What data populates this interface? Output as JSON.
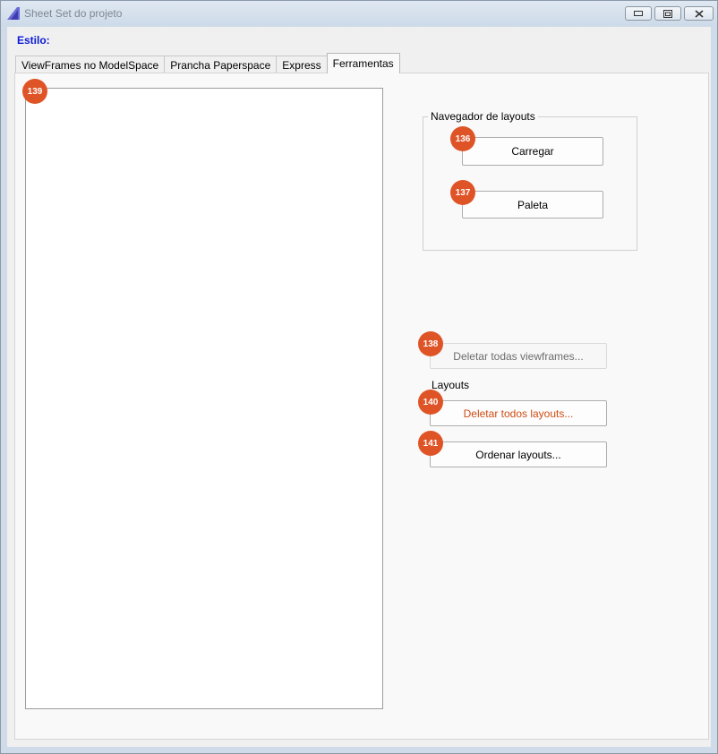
{
  "window": {
    "title": "Sheet Set do projeto",
    "controls": {
      "minimize": "minimize-icon",
      "restore": "restore-icon",
      "close": "close-icon"
    }
  },
  "estilo_label": "Estilo:",
  "tabs": [
    {
      "label": "ViewFrames no ModelSpace",
      "active": false
    },
    {
      "label": "Prancha Paperspace",
      "active": false
    },
    {
      "label": "Express",
      "active": false
    },
    {
      "label": "Ferramentas",
      "active": true
    }
  ],
  "navegador": {
    "group_label": "Navegador de layouts",
    "carregar_label": "Carregar",
    "paleta_label": "Paleta"
  },
  "actions": {
    "delete_viewframes_label": "Deletar todas viewframes...",
    "layouts_label": "Layouts",
    "delete_layouts_label": "Deletar todos layouts...",
    "sort_layouts_label": "Ordenar layouts..."
  },
  "badges": {
    "listbox": "139",
    "carregar": "136",
    "paleta": "137",
    "delete_viewframes": "138",
    "delete_layouts": "140",
    "sort_layouts": "141"
  },
  "colors": {
    "estilo": "#0b1ad6",
    "badge": "#df5427",
    "danger_text": "#cf4b12"
  }
}
